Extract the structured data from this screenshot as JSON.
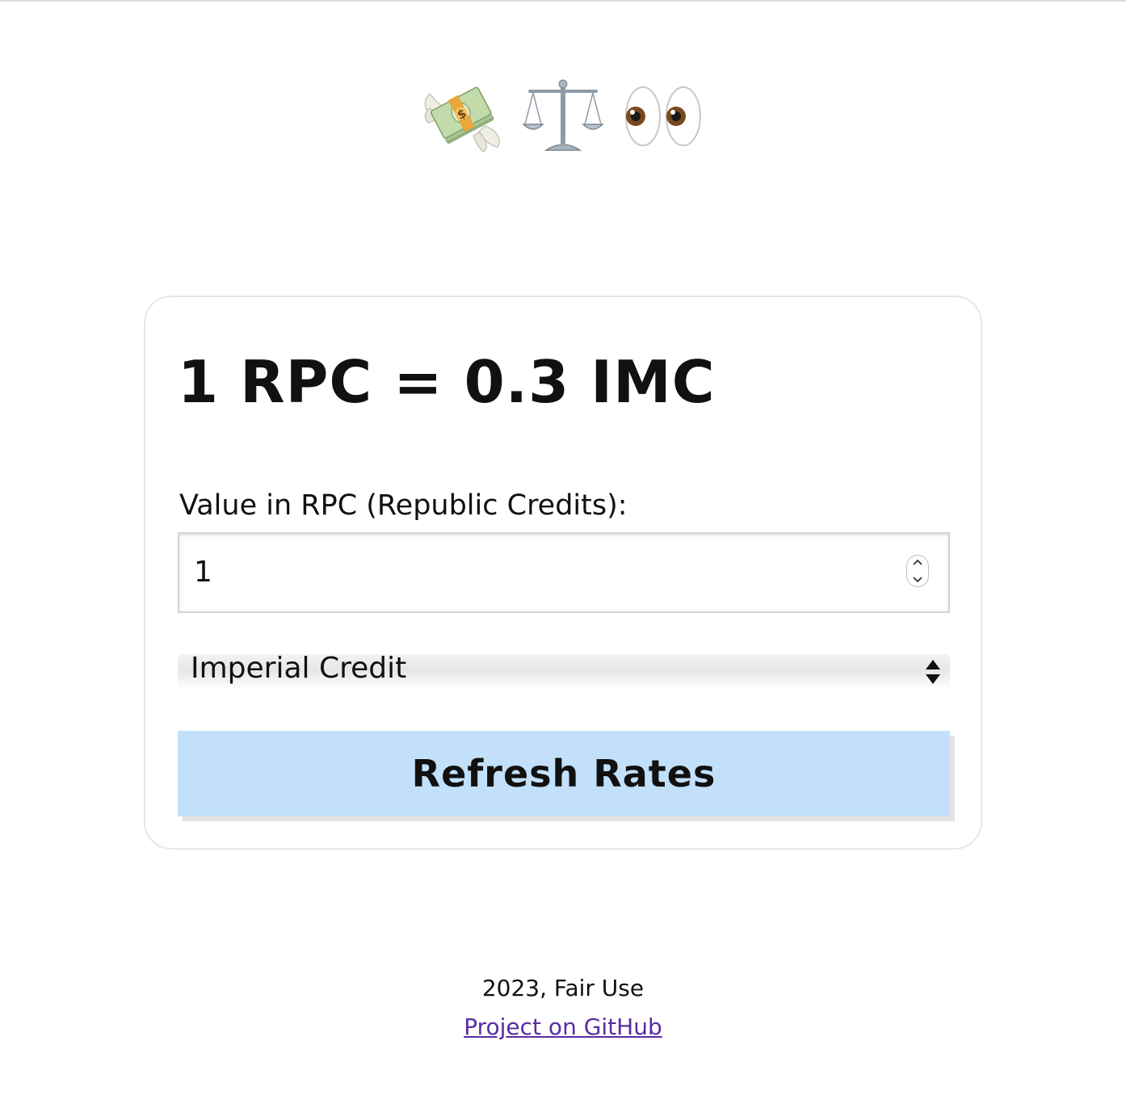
{
  "header": {
    "emojis": [
      {
        "name": "money-with-wings-icon"
      },
      {
        "name": "balance-scale-icon"
      },
      {
        "name": "eyes-icon"
      }
    ]
  },
  "converter": {
    "rate_text": "1 RPC = 0.3 IMC",
    "value_label": "Value in RPC (Republic Credits):",
    "amount_value": "1",
    "selected_currency": "Imperial Credit",
    "refresh_label": "Refresh Rates",
    "button_color": "#c2e0fa"
  },
  "footer": {
    "text": "2023, Fair Use",
    "link_label": "Project on GitHub",
    "link_color": "#5a2da0"
  }
}
